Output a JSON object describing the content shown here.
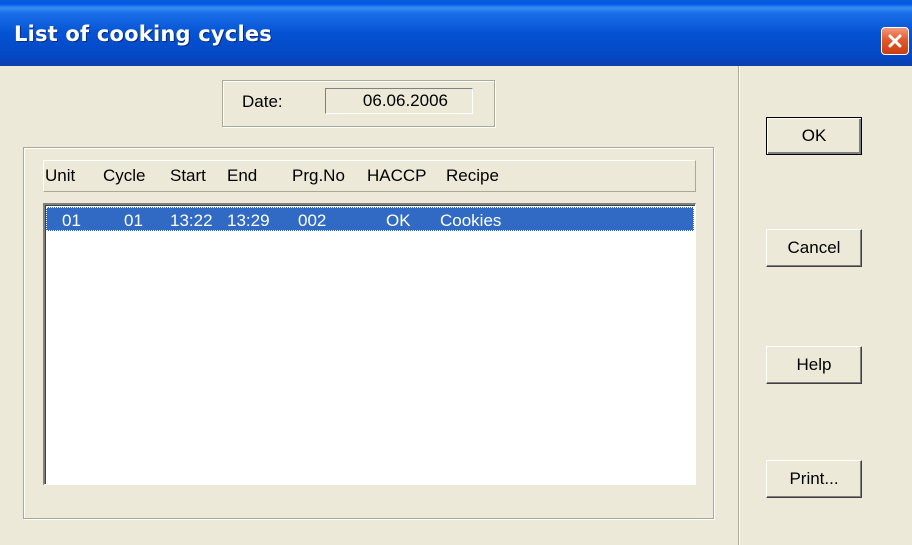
{
  "window": {
    "title": "List of cooking cycles"
  },
  "date": {
    "label": "Date:",
    "value": "06.06.2006"
  },
  "table": {
    "columns": [
      "Unit",
      "Cycle",
      "Start",
      "End",
      "Prg.No",
      "HACCP",
      "Recipe"
    ],
    "rows": [
      {
        "unit": "01",
        "cycle": "01",
        "start": "13:22",
        "end": "13:29",
        "prg_no": "002",
        "haccp": "OK",
        "recipe": "Cookies"
      }
    ]
  },
  "buttons": {
    "ok": "OK",
    "cancel": "Cancel",
    "help": "Help",
    "print": "Print..."
  },
  "colors": {
    "titlebar": "#0553d4",
    "selection": "#316ac5",
    "close_button": "#e2592b",
    "dialog_background": "#ece9d8"
  },
  "icons": {
    "close": "close-icon"
  }
}
